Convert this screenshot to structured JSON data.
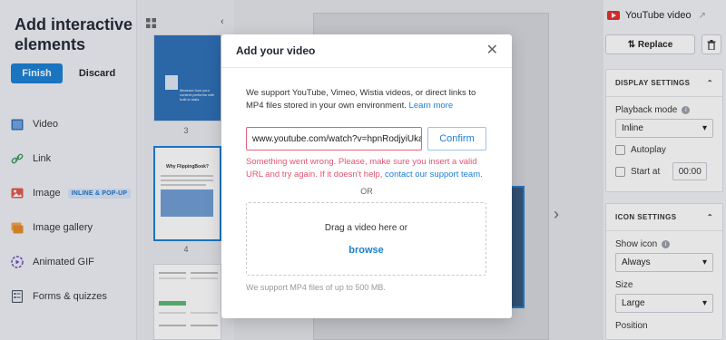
{
  "sidebar": {
    "title": "Add interactive elements",
    "finish_label": "Finish",
    "discard_label": "Discard",
    "items": [
      {
        "label": "Video",
        "icon": "video-icon"
      },
      {
        "label": "Link",
        "icon": "link-icon"
      },
      {
        "label": "Image",
        "icon": "image-icon",
        "badge": "INLINE & POP-UP"
      },
      {
        "label": "Image gallery",
        "icon": "gallery-icon"
      },
      {
        "label": "Animated GIF",
        "icon": "gif-icon"
      },
      {
        "label": "Forms & quizzes",
        "icon": "form-icon"
      }
    ]
  },
  "thumbnails": {
    "pages": [
      "3",
      "4"
    ],
    "thumb_texts": [
      "Measure how your content performs with built-in stats",
      "Why FlippingBook?"
    ]
  },
  "panel": {
    "title": "YouTube video",
    "replace_label": "Replace",
    "display": {
      "header": "DISPLAY SETTINGS",
      "playback_label": "Playback mode",
      "playback_value": "Inline",
      "autoplay_label": "Autoplay",
      "startat_label": "Start at",
      "startat_value": "00:00"
    },
    "icon": {
      "header": "ICON SETTINGS",
      "show_label": "Show icon",
      "show_value": "Always",
      "size_label": "Size",
      "size_value": "Large",
      "position_label": "Position"
    }
  },
  "modal": {
    "title": "Add your video",
    "description": "We support YouTube, Vimeo, Wistia videos, or direct links to MP4 files stored in your own environment.",
    "learn_more": "Learn more",
    "url_value": "www.youtube.com/watch?v=hpnRodjyiUka",
    "confirm_label": "Confirm",
    "error_text": "Something went wrong. Please, make sure you insert a valid URL and try again. If it doesn't help,",
    "error_link": "contact our support team.",
    "or_label": "OR",
    "drop_text": "Drag a video here or",
    "browse_label": "browse",
    "note": "We support MP4 files of up to 500 MB."
  },
  "colors": {
    "accent": "#1a7fd4",
    "error": "#e05573",
    "youtube": "#e52d27"
  }
}
